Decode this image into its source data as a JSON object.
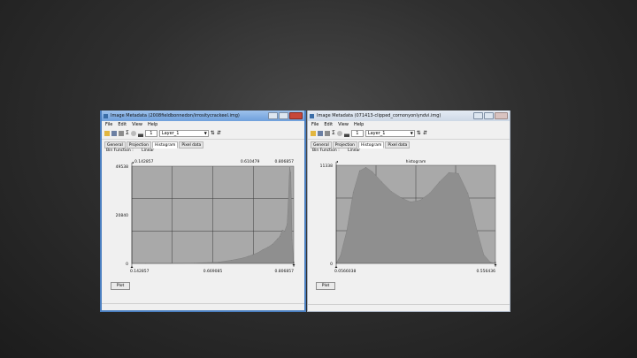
{
  "windows": [
    {
      "title": "Image Metadata (2008fieldbonnedon/irrositycrackeel.img)",
      "menu": [
        "File",
        "Edit",
        "View",
        "Help"
      ],
      "toolbar": {
        "page_value": "1",
        "layer_value": "Layer_1"
      },
      "tabs": [
        "General",
        "Projection",
        "Histogram",
        "Pixel data"
      ],
      "active_tab": "Histogram",
      "bin_function_label": "Bin Function :",
      "bin_function_value": "Linear",
      "plot_button": "Plot",
      "histogram": {
        "title": "",
        "y_ticks": [
          "49538",
          "20840",
          "0"
        ],
        "top_left_label": "0.142857",
        "top_mid_label": "0.610479",
        "top_right_label": "0.806857",
        "bottom_left_label": "0.142857",
        "bottom_mid_label": "0.669085",
        "bottom_right_label": "0.806857"
      },
      "chart_data": {
        "type": "area",
        "title": "",
        "x": [
          0.143,
          0.2,
          0.3,
          0.4,
          0.5,
          0.55,
          0.6,
          0.62,
          0.64,
          0.66,
          0.68,
          0.7,
          0.72,
          0.74,
          0.75,
          0.76,
          0.77,
          0.78,
          0.785,
          0.79,
          0.795,
          0.8,
          0.807
        ],
        "y": [
          0,
          0,
          0,
          150,
          700,
          1600,
          2800,
          3600,
          4500,
          5500,
          7000,
          8200,
          9800,
          12500,
          13800,
          17000,
          16500,
          20000,
          33000,
          49000,
          46000,
          12000,
          0
        ],
        "xlim": [
          0.142857,
          0.806857
        ],
        "ylim": [
          0,
          49538
        ]
      }
    },
    {
      "title": "Image Metadata (071413-clipped_cornonyonlyndvi.img)",
      "menu": [
        "File",
        "Edit",
        "View",
        "Help"
      ],
      "toolbar": {
        "page_value": "1",
        "layer_value": "Layer_1"
      },
      "tabs": [
        "General",
        "Projection",
        "Histogram",
        "Pixel data"
      ],
      "active_tab": "Histogram",
      "bin_function_label": "Bin Function :",
      "bin_function_value": "Linear",
      "plot_button": "Plot",
      "histogram": {
        "title": "histogram",
        "y_ticks": [
          "11338",
          "0"
        ],
        "bottom_left_label": "0.0566038",
        "bottom_right_label": "0.556436"
      },
      "chart_data": {
        "type": "area",
        "title": "histogram",
        "x": [
          0.0566,
          0.07,
          0.09,
          0.11,
          0.13,
          0.15,
          0.17,
          0.2,
          0.23,
          0.26,
          0.29,
          0.32,
          0.35,
          0.38,
          0.41,
          0.44,
          0.47,
          0.5,
          0.52,
          0.54,
          0.5564
        ],
        "y": [
          0,
          900,
          3800,
          8200,
          10700,
          11100,
          10600,
          9400,
          8300,
          7600,
          7100,
          7300,
          8100,
          9400,
          10500,
          10400,
          8100,
          3600,
          1000,
          150,
          0
        ],
        "xlim": [
          0.0566038,
          0.556436
        ],
        "ylim": [
          0,
          11338
        ]
      }
    }
  ]
}
